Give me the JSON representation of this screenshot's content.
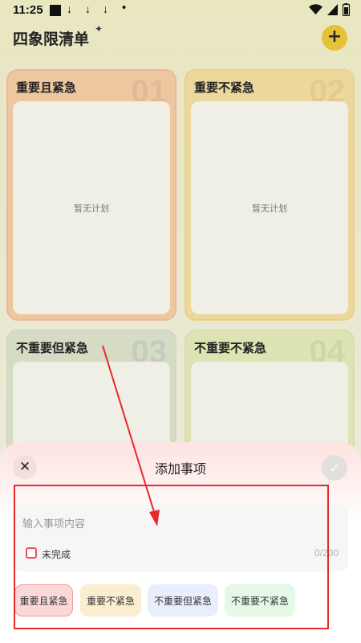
{
  "status_bar": {
    "time": "11:25",
    "download_icon": "↓",
    "dot": "•"
  },
  "header": {
    "title": "四象限清单",
    "sparkle": "✦",
    "add_label": "+"
  },
  "quadrants": [
    {
      "title": "重要且紧急",
      "number": "01",
      "empty_text": "暂无计划"
    },
    {
      "title": "重要不紧急",
      "number": "02",
      "empty_text": "暂无计划"
    },
    {
      "title": "不重要但紧急",
      "number": "03",
      "empty_text": ""
    },
    {
      "title": "不重要不紧急",
      "number": "04",
      "empty_text": ""
    }
  ],
  "sheet": {
    "title": "添加事项",
    "close_label": "✕",
    "confirm_label": "✓",
    "input": {
      "placeholder": "输入事项内容",
      "value": ""
    },
    "checkbox_label": "未完成",
    "counter": "0/200",
    "chips": [
      "重要且紧急",
      "重要不紧急",
      "不重要但紧急",
      "不重要不紧急"
    ],
    "selected_chip": "重要且紧急"
  },
  "colors": {
    "accent_red": "#e52a2a",
    "add_button": "#e6c23a",
    "chip_selected_bg": "#fbd8d8"
  }
}
